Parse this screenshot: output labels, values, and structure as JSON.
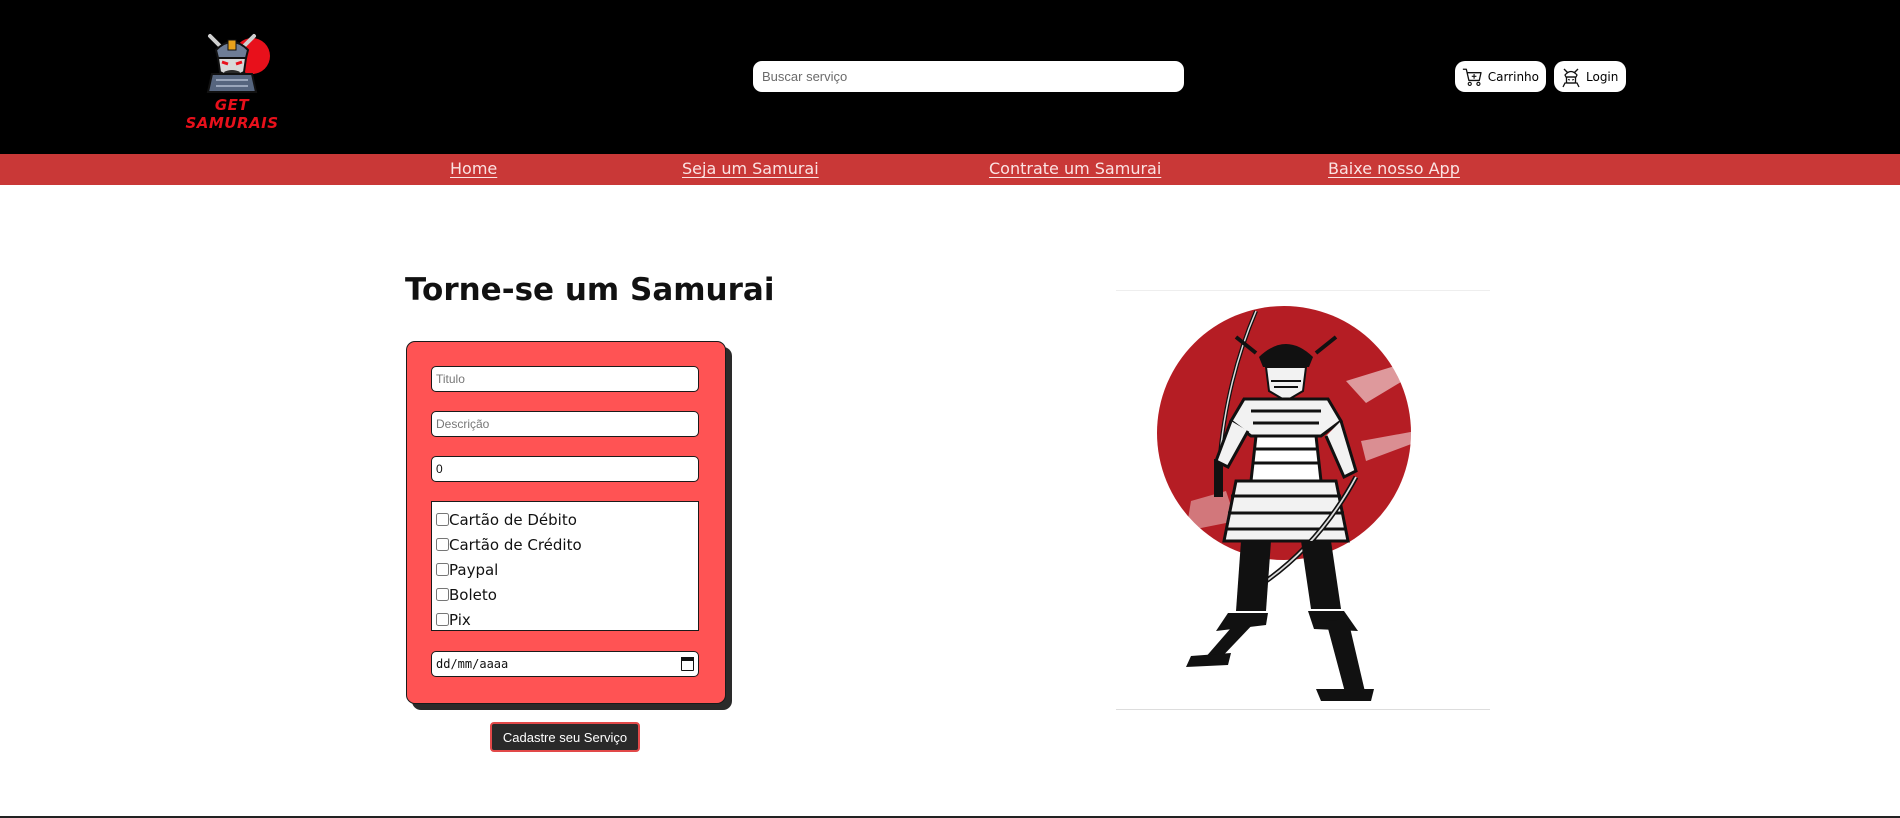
{
  "brand": {
    "name": "GET SAMURAIS",
    "accent": "#e8101b"
  },
  "search": {
    "placeholder": "Buscar serviço"
  },
  "header_actions": {
    "cart_label": "Carrinho",
    "login_label": "Login"
  },
  "nav": {
    "items": [
      "Home",
      "Seja um Samurai",
      "Contrate um Samurai",
      "Baixe nosso App"
    ]
  },
  "page": {
    "title": "Torne-se um Samurai"
  },
  "form": {
    "title_placeholder": "Titulo",
    "description_placeholder": "Descrição",
    "price_value": "0",
    "payment_options": [
      "Cartão de Débito",
      "Cartão de Crédito",
      "Paypal",
      "Boleto",
      "Pix"
    ],
    "date_placeholder": "dd/mm/aaaa",
    "submit_label": "Cadastre seu Serviço"
  },
  "colors": {
    "header_bg": "#000000",
    "nav_bg": "#c93837",
    "card_bg": "#ff5354",
    "sun_red": "#b51d24"
  },
  "icons": [
    "samurai-logo-icon",
    "cart-icon",
    "login-samurai-icon",
    "calendar-icon"
  ]
}
